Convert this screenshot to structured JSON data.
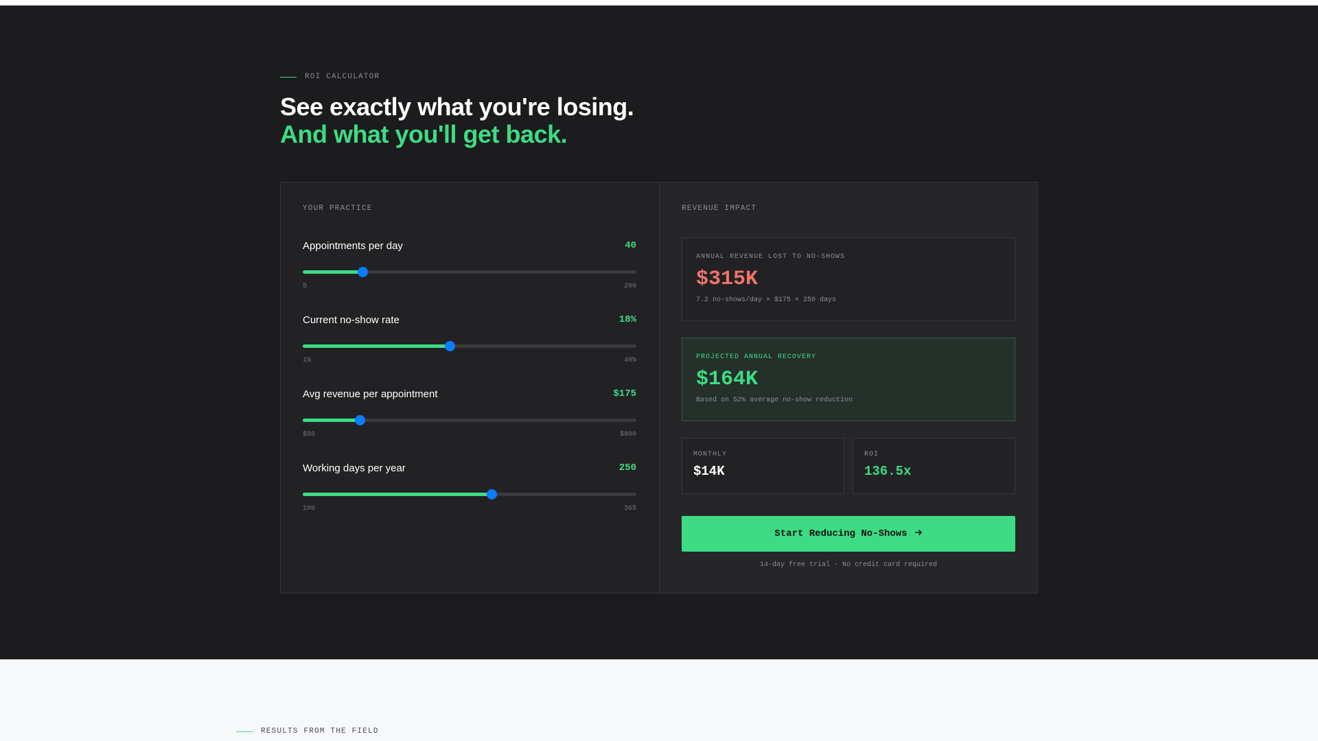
{
  "hero": {
    "eyebrow": "ROI CALCULATOR",
    "headline_line1": "See exactly what you're losing.",
    "headline_line2": "And what you'll get back."
  },
  "practice": {
    "panel_label": "YOUR PRACTICE",
    "sliders": [
      {
        "label": "Appointments per day",
        "value": "40",
        "min": "5",
        "max": "200",
        "position": 0.18
      },
      {
        "label": "Current no-show rate",
        "value": "18%",
        "min": "1%",
        "max": "40%",
        "position": 0.44
      },
      {
        "label": "Avg revenue per appointment",
        "value": "$175",
        "min": "$50",
        "max": "$800",
        "position": 0.17
      },
      {
        "label": "Working days per year",
        "value": "250",
        "min": "100",
        "max": "365",
        "position": 0.565
      }
    ]
  },
  "impact": {
    "panel_label": "REVENUE IMPACT",
    "lost": {
      "label": "ANNUAL REVENUE LOST TO NO-SHOWS",
      "value": "$315K",
      "note": "7.2 no-shows/day × $175 × 250 days"
    },
    "recovery": {
      "label": "PROJECTED ANNUAL RECOVERY",
      "value": "$164K",
      "note": "Based on 52% average no-show reduction"
    },
    "monthly": {
      "label": "MONTHLY",
      "value": "$14K"
    },
    "roi": {
      "label": "ROI",
      "value": "136.5x"
    },
    "cta_label": "Start Reducing No-Shows",
    "fineprint": "14-day free trial · No credit card required"
  },
  "next_section": {
    "eyebrow": "RESULTS FROM THE FIELD"
  },
  "colors": {
    "accent": "#3ddc84",
    "loss": "#f0736a",
    "slider_thumb": "#0a7cff",
    "background": "#1c1c1e"
  }
}
